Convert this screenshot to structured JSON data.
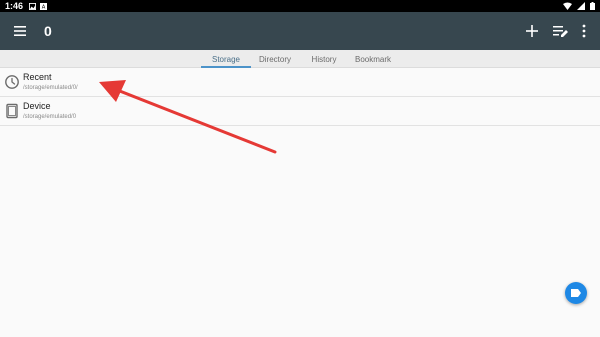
{
  "status_bar": {
    "time": "1:46",
    "left_icons": [
      "image-icon",
      "notification-icon"
    ],
    "right_icons": [
      "wifi-icon",
      "signal-icon",
      "battery-icon"
    ]
  },
  "app_bar": {
    "title": "0",
    "menu_icon": "menu-icon",
    "actions": [
      "add-icon",
      "edit-list-icon",
      "more-vert-icon"
    ],
    "background": "#37474f"
  },
  "tabs": [
    {
      "label": "Storage",
      "active": true
    },
    {
      "label": "Directory",
      "active": false
    },
    {
      "label": "History",
      "active": false
    },
    {
      "label": "Bookmark",
      "active": false
    }
  ],
  "list": [
    {
      "title": "Recent",
      "subtitle": "/storage/emulated/0/",
      "icon": "clock-icon"
    },
    {
      "title": "Device",
      "subtitle": "/storage/emulated/0",
      "icon": "tablet-icon"
    }
  ],
  "fab": {
    "icon": "label-icon",
    "color": "#1e88e5"
  },
  "annotation": {
    "type": "arrow",
    "color": "#e53935"
  },
  "colors": {
    "accent": "#4c93c9",
    "background": "#fafafa"
  }
}
